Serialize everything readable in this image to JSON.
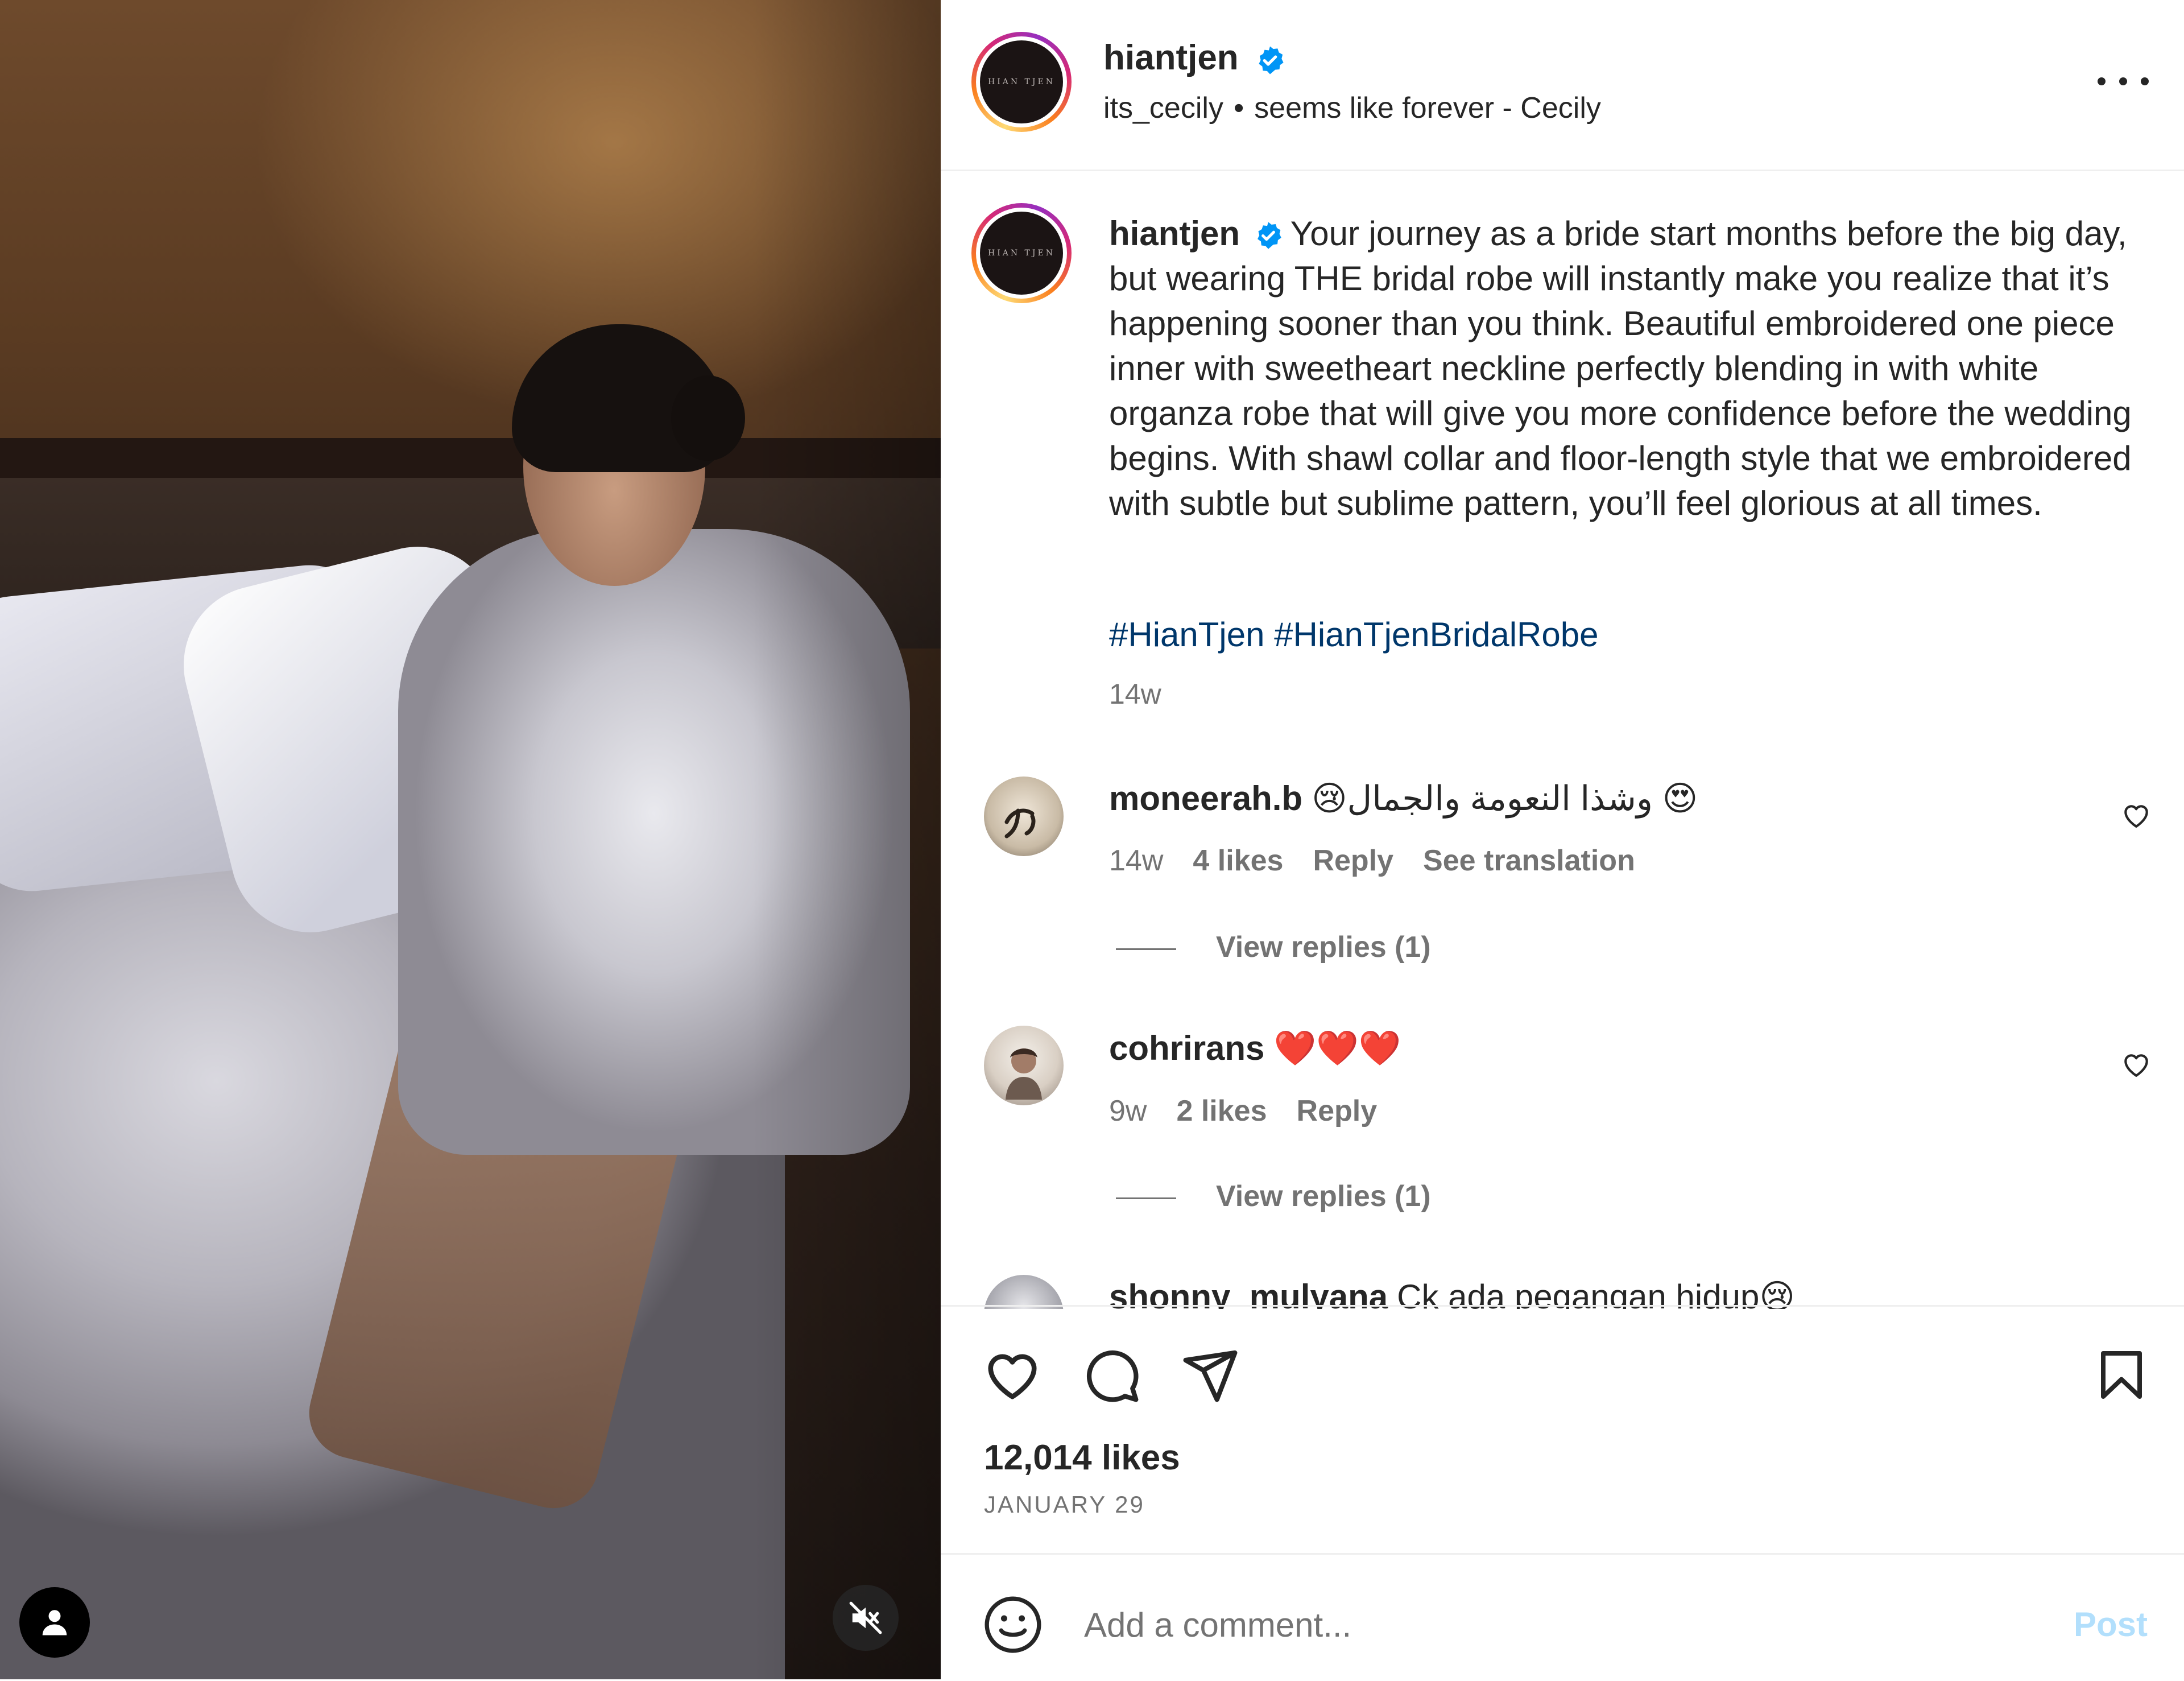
{
  "post": {
    "author": "hiantjen",
    "logo_text": "HIAN TJEN",
    "audio_user": "its_cecily",
    "audio_separator": "•",
    "audio_track": "seems like forever - Cecily"
  },
  "caption": {
    "username": "hiantjen",
    "text": "Your journey as a bride start months before the big day, but wearing THE bridal robe will instantly make you realize that it’s happening sooner than you think. Beautiful embroidered one piece inner with sweetheart neckline perfectly blending in with white organza robe that will give you more confidence before the wedding begins. With shawl collar and floor-length style that we embroidered with subtle but sublime pattern, you’ll feel glorious at all times.",
    "hashtags": "#HianTjen #HianTjenBridalRobe",
    "time": "14w"
  },
  "comments": [
    {
      "username": "moneerah.b",
      "text": "😢وشذا النعومة والجمال 😍",
      "time": "14w",
      "likes": "4 likes",
      "reply": "Reply",
      "translate": "See translation",
      "replies": "View replies (1)"
    },
    {
      "username": "cohrirans",
      "text": "❤️❤️❤️",
      "time": "9w",
      "likes": "2 likes",
      "reply": "Reply",
      "replies": "View replies (1)"
    },
    {
      "username": "shonny_mulyana",
      "text": "Ck ada pegangan hidup😢"
    }
  ],
  "stats": {
    "likes": "12,014 likes",
    "date": "JANUARY 29"
  },
  "composer": {
    "placeholder": "Add a comment...",
    "post_label": "Post"
  },
  "colors": {
    "link": "#00376b",
    "secondary_text": "#737373",
    "verified": "#0095f6",
    "post_disabled": "#b2dffc"
  },
  "icons": [
    "verified-badge-icon",
    "more-options-icon",
    "heart-icon",
    "comment-icon",
    "share-icon",
    "bookmark-icon",
    "emoji-icon",
    "user-icon",
    "muted-speaker-icon"
  ]
}
